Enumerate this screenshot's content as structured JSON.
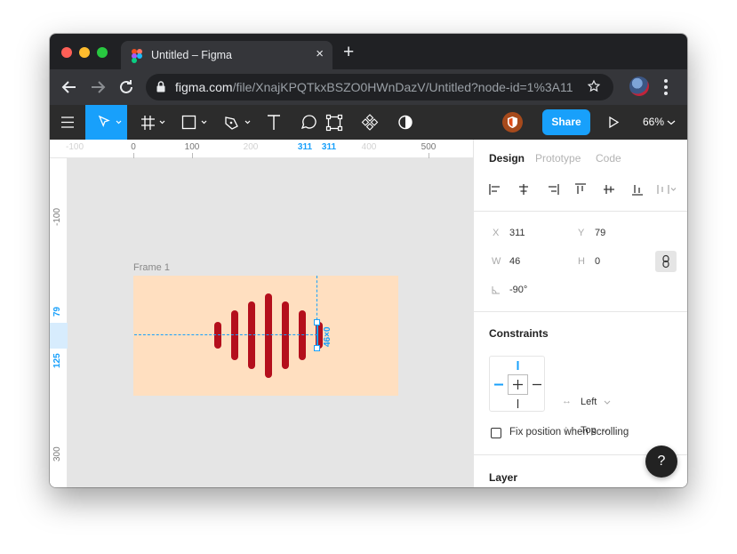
{
  "browser": {
    "tab_title": "Untitled – Figma",
    "tab_close_glyph": "×",
    "new_tab_glyph": "+",
    "url_host": "figma.com",
    "url_path": "/file/XnajKPQTkxBSZO0HWnDazV/Untitled?node-id=1%3A11"
  },
  "toolbar": {
    "share_label": "Share",
    "zoom_label": "66%",
    "icons": [
      "menu-icon",
      "move-icon",
      "frame-icon",
      "shape-icon",
      "pen-icon",
      "text-icon",
      "comment-icon",
      "component-icon",
      "components-icon",
      "mask-icon",
      "play-icon"
    ]
  },
  "rulers": {
    "top": [
      {
        "label": "-100",
        "faint": true
      },
      {
        "label": "0",
        "faint": false
      },
      {
        "label": "100",
        "faint": false
      },
      {
        "label": "200",
        "faint": true
      },
      {
        "label": "311",
        "selected": true
      },
      {
        "label": "311",
        "selected": true
      },
      {
        "label": "400",
        "faint": true
      },
      {
        "label": "500",
        "faint": false
      }
    ],
    "left": {
      "minus100": "-100",
      "sel_start": "79",
      "sel_end": "125",
      "val300": "300"
    }
  },
  "canvas": {
    "frame_name": "Frame 1",
    "frame_color": "#FFDFC0",
    "bar_color": "#B40F1C",
    "dimension_label": "46×0",
    "bar_heights": [
      30,
      56,
      76,
      95,
      76,
      56,
      30
    ]
  },
  "panel": {
    "tabs": [
      "Design",
      "Prototype",
      "Code"
    ],
    "active_tab": "Design",
    "x_label": "X",
    "x_value": "311",
    "y_label": "Y",
    "y_value": "79",
    "w_label": "W",
    "w_value": "46",
    "h_label": "H",
    "h_value": "0",
    "rotation_value": "-90°",
    "constraints_title": "Constraints",
    "constraint_h": "Left",
    "constraint_v": "Top",
    "fix_position_label": "Fix position when scrolling",
    "fix_position_checked": false,
    "layer_title": "Layer",
    "help_label": "?"
  },
  "colors": {
    "accent": "#18A0FB",
    "toolbar_bg": "#2C2C2C",
    "chrome_bg": "#202124"
  }
}
